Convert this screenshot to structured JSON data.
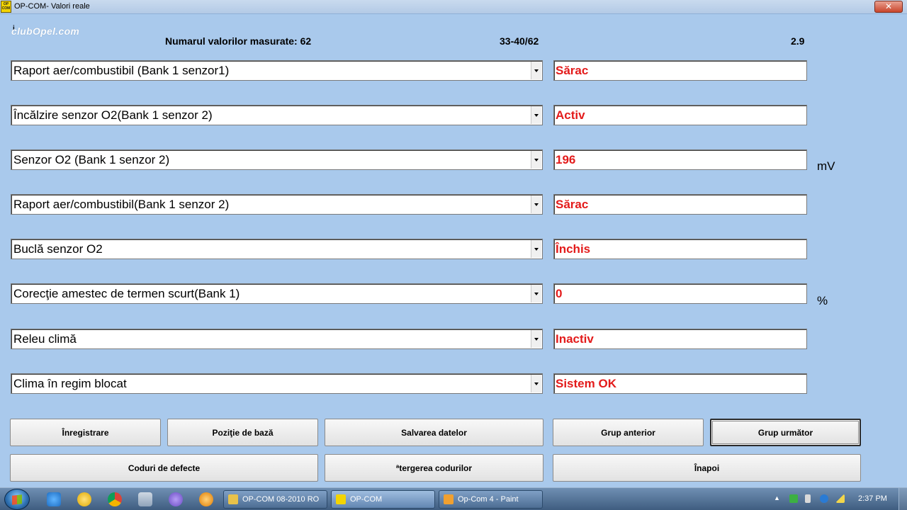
{
  "window": {
    "title": "OP-COM- Valori reale",
    "logo_text": "OP COM",
    "close_glyph": "✕"
  },
  "header": {
    "watermark": "clubOpel.com",
    "marker": "i",
    "count_label": "Numarul valorilor masurate: 62",
    "range": "33-40/62",
    "version": "2.9"
  },
  "rows": [
    {
      "label": "Raport aer/combustibil (Bank 1 senzor1)",
      "value": "Sărac",
      "unit": ""
    },
    {
      "label": "Încălzire senzor O2(Bank 1 senzor 2)",
      "value": "Activ",
      "unit": ""
    },
    {
      "label": "Senzor O2 (Bank 1 senzor 2)",
      "value": "196",
      "unit": "mV"
    },
    {
      "label": "Raport aer/combustibil(Bank 1 senzor 2)",
      "value": "Sărac",
      "unit": ""
    },
    {
      "label": "Buclă senzor O2",
      "value": "Închis",
      "unit": ""
    },
    {
      "label": "Corecţie amestec de termen scurt(Bank 1)",
      "value": "0",
      "unit": "%"
    },
    {
      "label": "Releu climă",
      "value": "Inactiv",
      "unit": ""
    },
    {
      "label": "Clima în regim blocat",
      "value": "Sistem OK",
      "unit": ""
    }
  ],
  "buttons": {
    "record": "Înregistrare",
    "base_position": "Poziţie de bază",
    "save_data": "Salvarea datelor",
    "prev_group": "Grup anterior",
    "next_group": "Grup următor",
    "fault_codes": "Coduri de defecte",
    "clear_codes": "ªtergerea codurilor",
    "back": "Înapoi"
  },
  "taskbar": {
    "tasks": [
      {
        "label": "OP-COM 08-2010 RO",
        "icon": "folder-icon",
        "color": "#e8c24a"
      },
      {
        "label": "OP-COM",
        "icon": "opcom-icon",
        "color": "#f3d400"
      },
      {
        "label": "Op-Com 4 - Paint",
        "icon": "paint-icon",
        "color": "#f0a030"
      }
    ],
    "clock": "2:37 PM"
  }
}
